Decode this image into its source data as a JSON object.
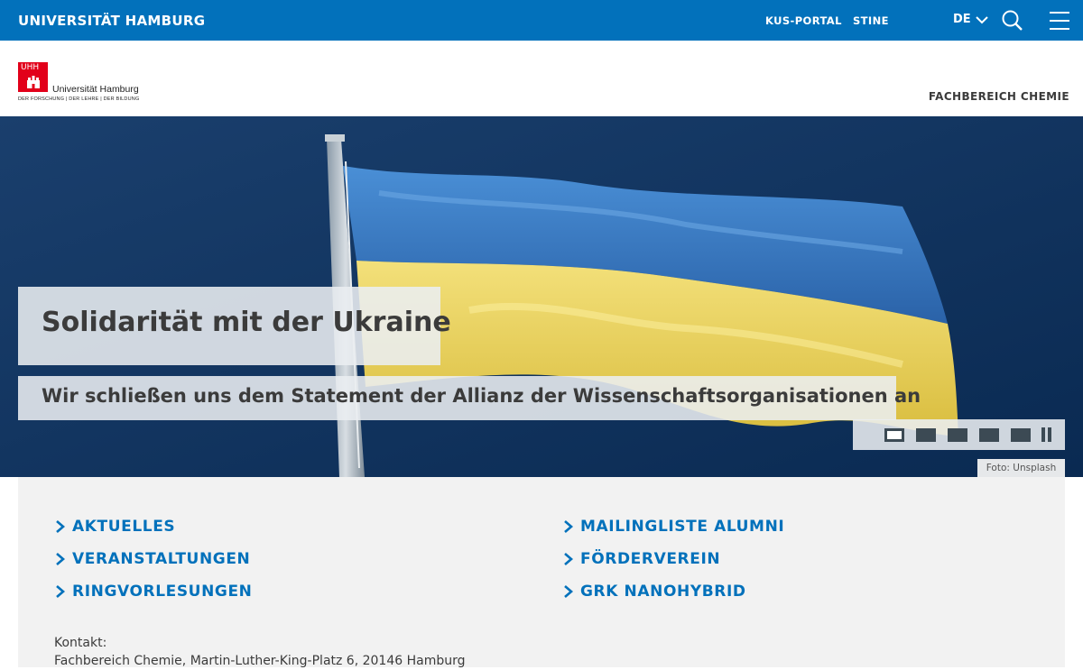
{
  "topbar": {
    "brand": "UNIVERSITÄT HAMBURG",
    "links": [
      "KUS-PORTAL",
      "STINE"
    ],
    "language": "DE",
    "icons": [
      "chevron-down-icon",
      "search-icon",
      "menu-icon"
    ]
  },
  "header": {
    "logo": {
      "mark": "UHH",
      "name": "Universität Hamburg",
      "tagline": "DER FORSCHUNG | DER LEHRE | DER BILDUNG"
    },
    "department": "FACHBEREICH CHEMIE"
  },
  "hero": {
    "title": "Solidarität mit der Ukraine",
    "subtitle": "Wir schließen uns dem Statement der Allianz der Wissenschaftsorganisationen an",
    "slides": 5,
    "active_slide": 1,
    "credit": "Foto: Unsplash",
    "colors": {
      "sky": "#0d2f57",
      "flag_blue": "#2f6fb8",
      "flag_yellow": "#e9d35a"
    }
  },
  "links": {
    "left": [
      "AKTUELLES",
      "VERANSTALTUNGEN",
      "RINGVORLESUNGEN"
    ],
    "right": [
      "MAILINGLISTE ALUMNI",
      "FÖRDERVEREIN",
      "GRK NANOHYBRID"
    ]
  },
  "contact": {
    "label": "Kontakt:",
    "address": "Fachbereich Chemie, Martin-Luther-King-Platz 6, 20146 Hamburg"
  },
  "colors": {
    "brand_blue": "#0271bb",
    "text_dark": "#3b3b3b",
    "panel_bg": "#f2f2f2",
    "logo_red": "#e2001a"
  }
}
